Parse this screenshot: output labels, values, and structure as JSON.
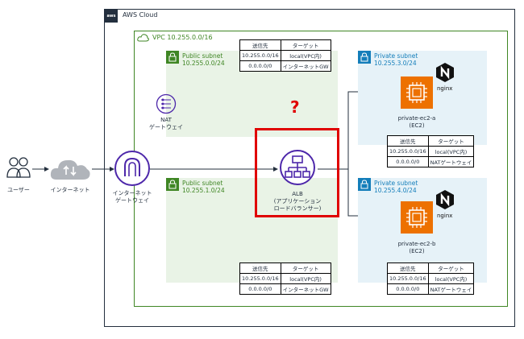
{
  "diagram": {
    "user": {
      "label": "ユーザー"
    },
    "internet": {
      "label": "インターネット"
    },
    "igw": {
      "label_line1": "インターネット",
      "label_line2": "ゲートウェイ"
    },
    "cloud": {
      "label": "AWS Cloud",
      "badge": "aws"
    },
    "vpc": {
      "label": "VPC 10.255.0.0/16"
    },
    "subnets": [
      {
        "name": "Public subnet",
        "cidr": "10.255.0.0/24"
      },
      {
        "name": "Public subnet",
        "cidr": "10.255.1.0/24"
      },
      {
        "name": "Private subnet",
        "cidr": "10.255.3.0/24"
      },
      {
        "name": "Private subnet",
        "cidr": "10.255.4.0/24"
      }
    ],
    "nat": {
      "label_line1": "NAT",
      "label_line2": "ゲートウェイ"
    },
    "alb": {
      "label_line1": "ALB",
      "label_line2": "(アプリケーション",
      "label_line3": "ロードバランサー)"
    },
    "question_mark": "?",
    "ec2": [
      {
        "name": "private-ec2-a",
        "type": "(EC2)",
        "badge": "nginx"
      },
      {
        "name": "private-ec2-b",
        "type": "(EC2)",
        "badge": "nginx"
      }
    ],
    "route_tables": {
      "public_top": {
        "headers": [
          "送信先",
          "ターゲット"
        ],
        "rows": [
          [
            "10.255.0.0/16",
            "local(VPC内)"
          ],
          [
            "0.0.0.0/0",
            "インターネットGW"
          ]
        ]
      },
      "public_bottom": {
        "headers": [
          "送信先",
          "ターゲット"
        ],
        "rows": [
          [
            "10.255.0.0/16",
            "local(VPC内)"
          ],
          [
            "0.0.0.0/0",
            "インターネットGW"
          ]
        ]
      },
      "private_top": {
        "headers": [
          "送信先",
          "ターゲット"
        ],
        "rows": [
          [
            "10.255.0.0/16",
            "local(VPC内)"
          ],
          [
            "0.0.0.0/0",
            "NATゲートウェイ"
          ]
        ]
      },
      "private_bottom": {
        "headers": [
          "送信先",
          "ターゲット"
        ],
        "rows": [
          [
            "10.255.0.0/16",
            "local(VPC内)"
          ],
          [
            "0.0.0.0/0",
            "NATゲートウェイ"
          ]
        ]
      }
    },
    "colors": {
      "public": "#3f8624",
      "private": "#147eba",
      "highlight": "#e00000",
      "service": "#4d27aa",
      "compute": "#ed7100"
    }
  }
}
